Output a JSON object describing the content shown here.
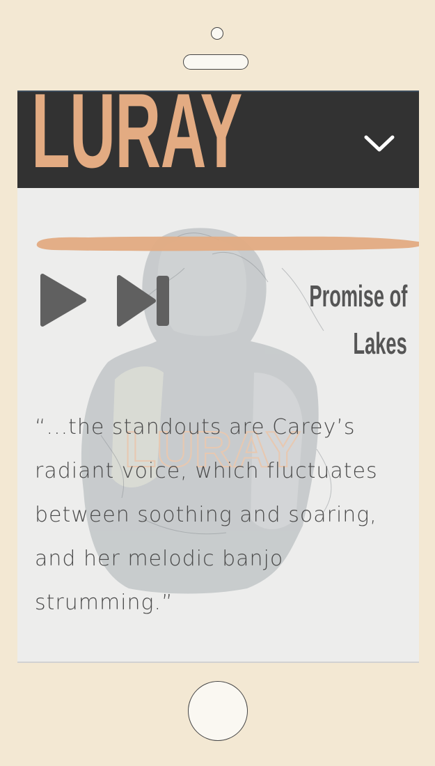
{
  "header": {
    "logo": "LURAY",
    "menu_icon": "chevron-down-icon"
  },
  "player": {
    "play_icon": "play-icon",
    "next_icon": "skip-forward-icon",
    "track_title_line1": "Promise of",
    "track_title_line2": "Lakes"
  },
  "quote": {
    "text": "“...the standouts are Carey’s radiant voice, which fluctuates between soothing and soaring, and her melodic banjo strumming.”"
  },
  "colors": {
    "page_background": "#f3e8d3",
    "header_background": "#323232",
    "accent_peach": "#e3ab82",
    "screen_background": "#ededec",
    "control_gray": "#606060"
  }
}
